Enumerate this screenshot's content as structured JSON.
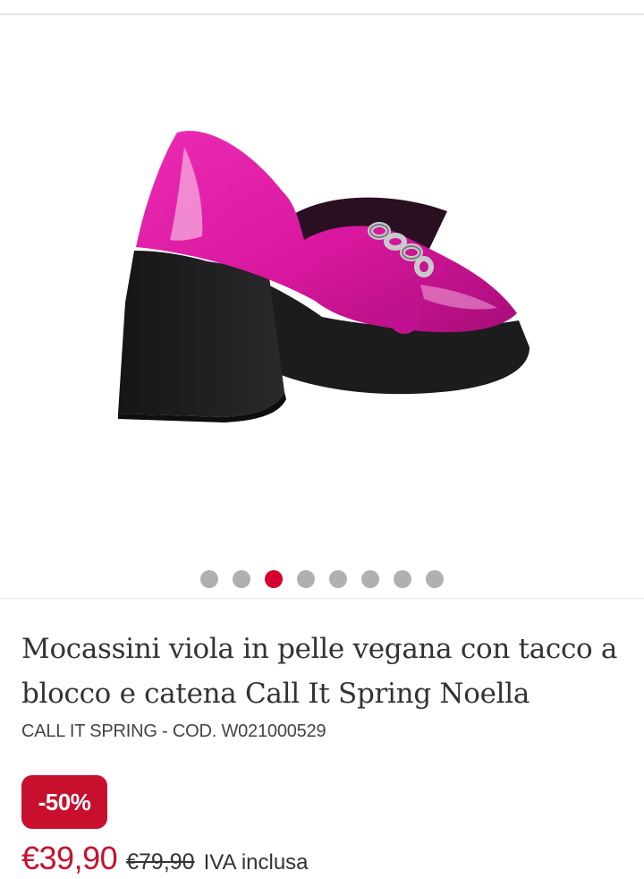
{
  "gallery": {
    "image_alt": "Mocassini viola in pelle vegana con tacco a blocco e catena Call It Spring Noella",
    "total_images": 8,
    "active_index": 2
  },
  "product": {
    "title": "Mocassini viola in pelle vegana con tacco a blocco e catena Call It Spring Noella",
    "brand": "CALL IT SPRING",
    "code_separator": " - ",
    "code": "COD. W021000529"
  },
  "pricing": {
    "discount_badge": "-50%",
    "current_price": "€39,90",
    "original_price": "€79,90",
    "vat_note": "IVA inclusa"
  },
  "colors": {
    "accent": "#c8102e",
    "active_dot": "#d6002f",
    "inactive_dot": "#b0b0b0",
    "shoe_upper": "#d8179e",
    "sole": "#1c1c1e"
  }
}
